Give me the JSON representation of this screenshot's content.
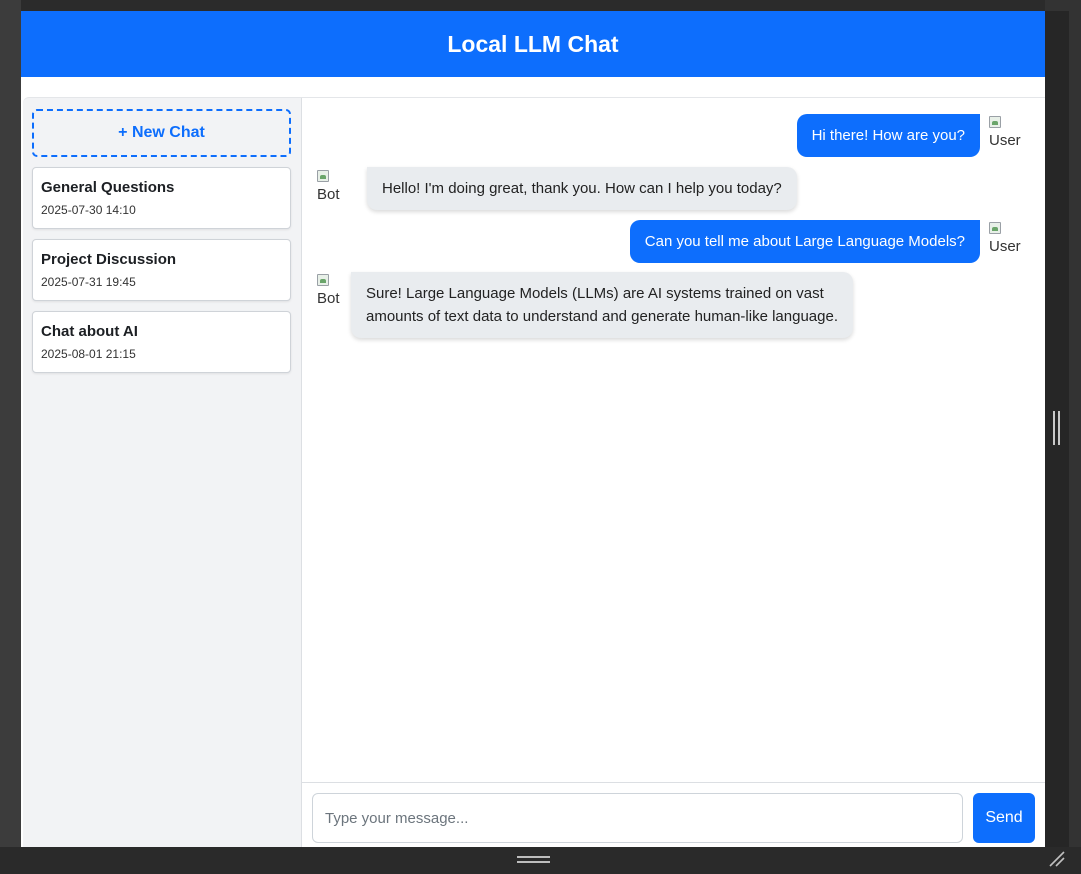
{
  "app": {
    "title": "Local LLM Chat"
  },
  "sidebar": {
    "new_chat_label": "+ New Chat",
    "chats": [
      {
        "title": "General Questions",
        "time": "2025-07-30 14:10"
      },
      {
        "title": "Project Discussion",
        "time": "2025-07-31 19:45"
      },
      {
        "title": "Chat about AI",
        "time": "2025-08-01 21:15"
      }
    ]
  },
  "messages": [
    {
      "role": "user",
      "avatar_alt": "User",
      "text": "Hi there! How are you?"
    },
    {
      "role": "bot",
      "avatar_alt": "Bot",
      "text": "Hello! I'm doing great, thank you. How can I help you today?"
    },
    {
      "role": "user",
      "avatar_alt": "User",
      "text": "Can you tell me about Large Language Models?"
    },
    {
      "role": "bot",
      "avatar_alt": "Bot",
      "text_lines": [
        "Sure! Large Language Models (LLMs) are AI systems trained on vast",
        "amounts of text data to understand and generate human-like language."
      ]
    }
  ],
  "composer": {
    "placeholder": "Type your message...",
    "value": "",
    "send_label": "Send"
  },
  "colors": {
    "primary": "#0d6efd",
    "bot_bubble": "#e9ecef",
    "sidebar_bg": "#f2f3f5"
  }
}
